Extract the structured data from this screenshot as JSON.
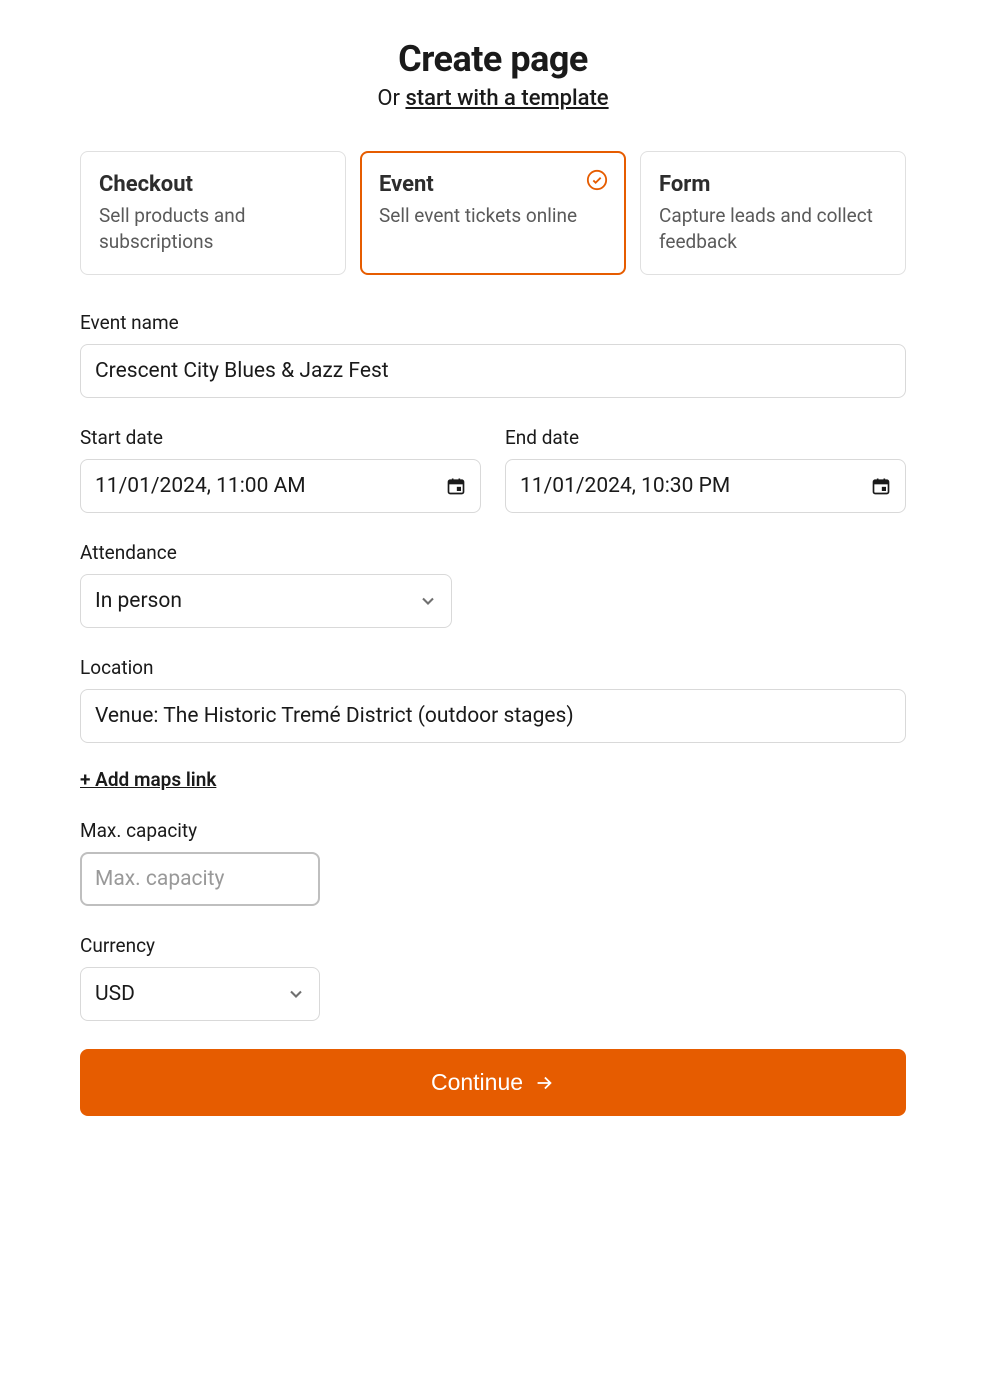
{
  "header": {
    "title": "Create page",
    "subtitle_prefix": "Or ",
    "subtitle_link": "start with a template"
  },
  "types": {
    "checkout": {
      "title": "Checkout",
      "desc": "Sell products and subscriptions"
    },
    "event": {
      "title": "Event",
      "desc": "Sell event tickets online"
    },
    "form": {
      "title": "Form",
      "desc": "Capture leads and collect feedback"
    }
  },
  "fields": {
    "event_name": {
      "label": "Event name",
      "value": "Crescent City Blues & Jazz Fest"
    },
    "start_date": {
      "label": "Start date",
      "value": "11/01/2024, 11:00 AM"
    },
    "end_date": {
      "label": "End date",
      "value": "11/01/2024, 10:30 PM"
    },
    "attendance": {
      "label": "Attendance",
      "value": "In person"
    },
    "location": {
      "label": "Location",
      "value": "Venue: The Historic Tremé District (outdoor stages)"
    },
    "maps_link": "+ Add maps link",
    "capacity": {
      "label": "Max. capacity",
      "placeholder": "Max. capacity"
    },
    "currency": {
      "label": "Currency",
      "value": "USD"
    }
  },
  "continue_button": "Continue"
}
